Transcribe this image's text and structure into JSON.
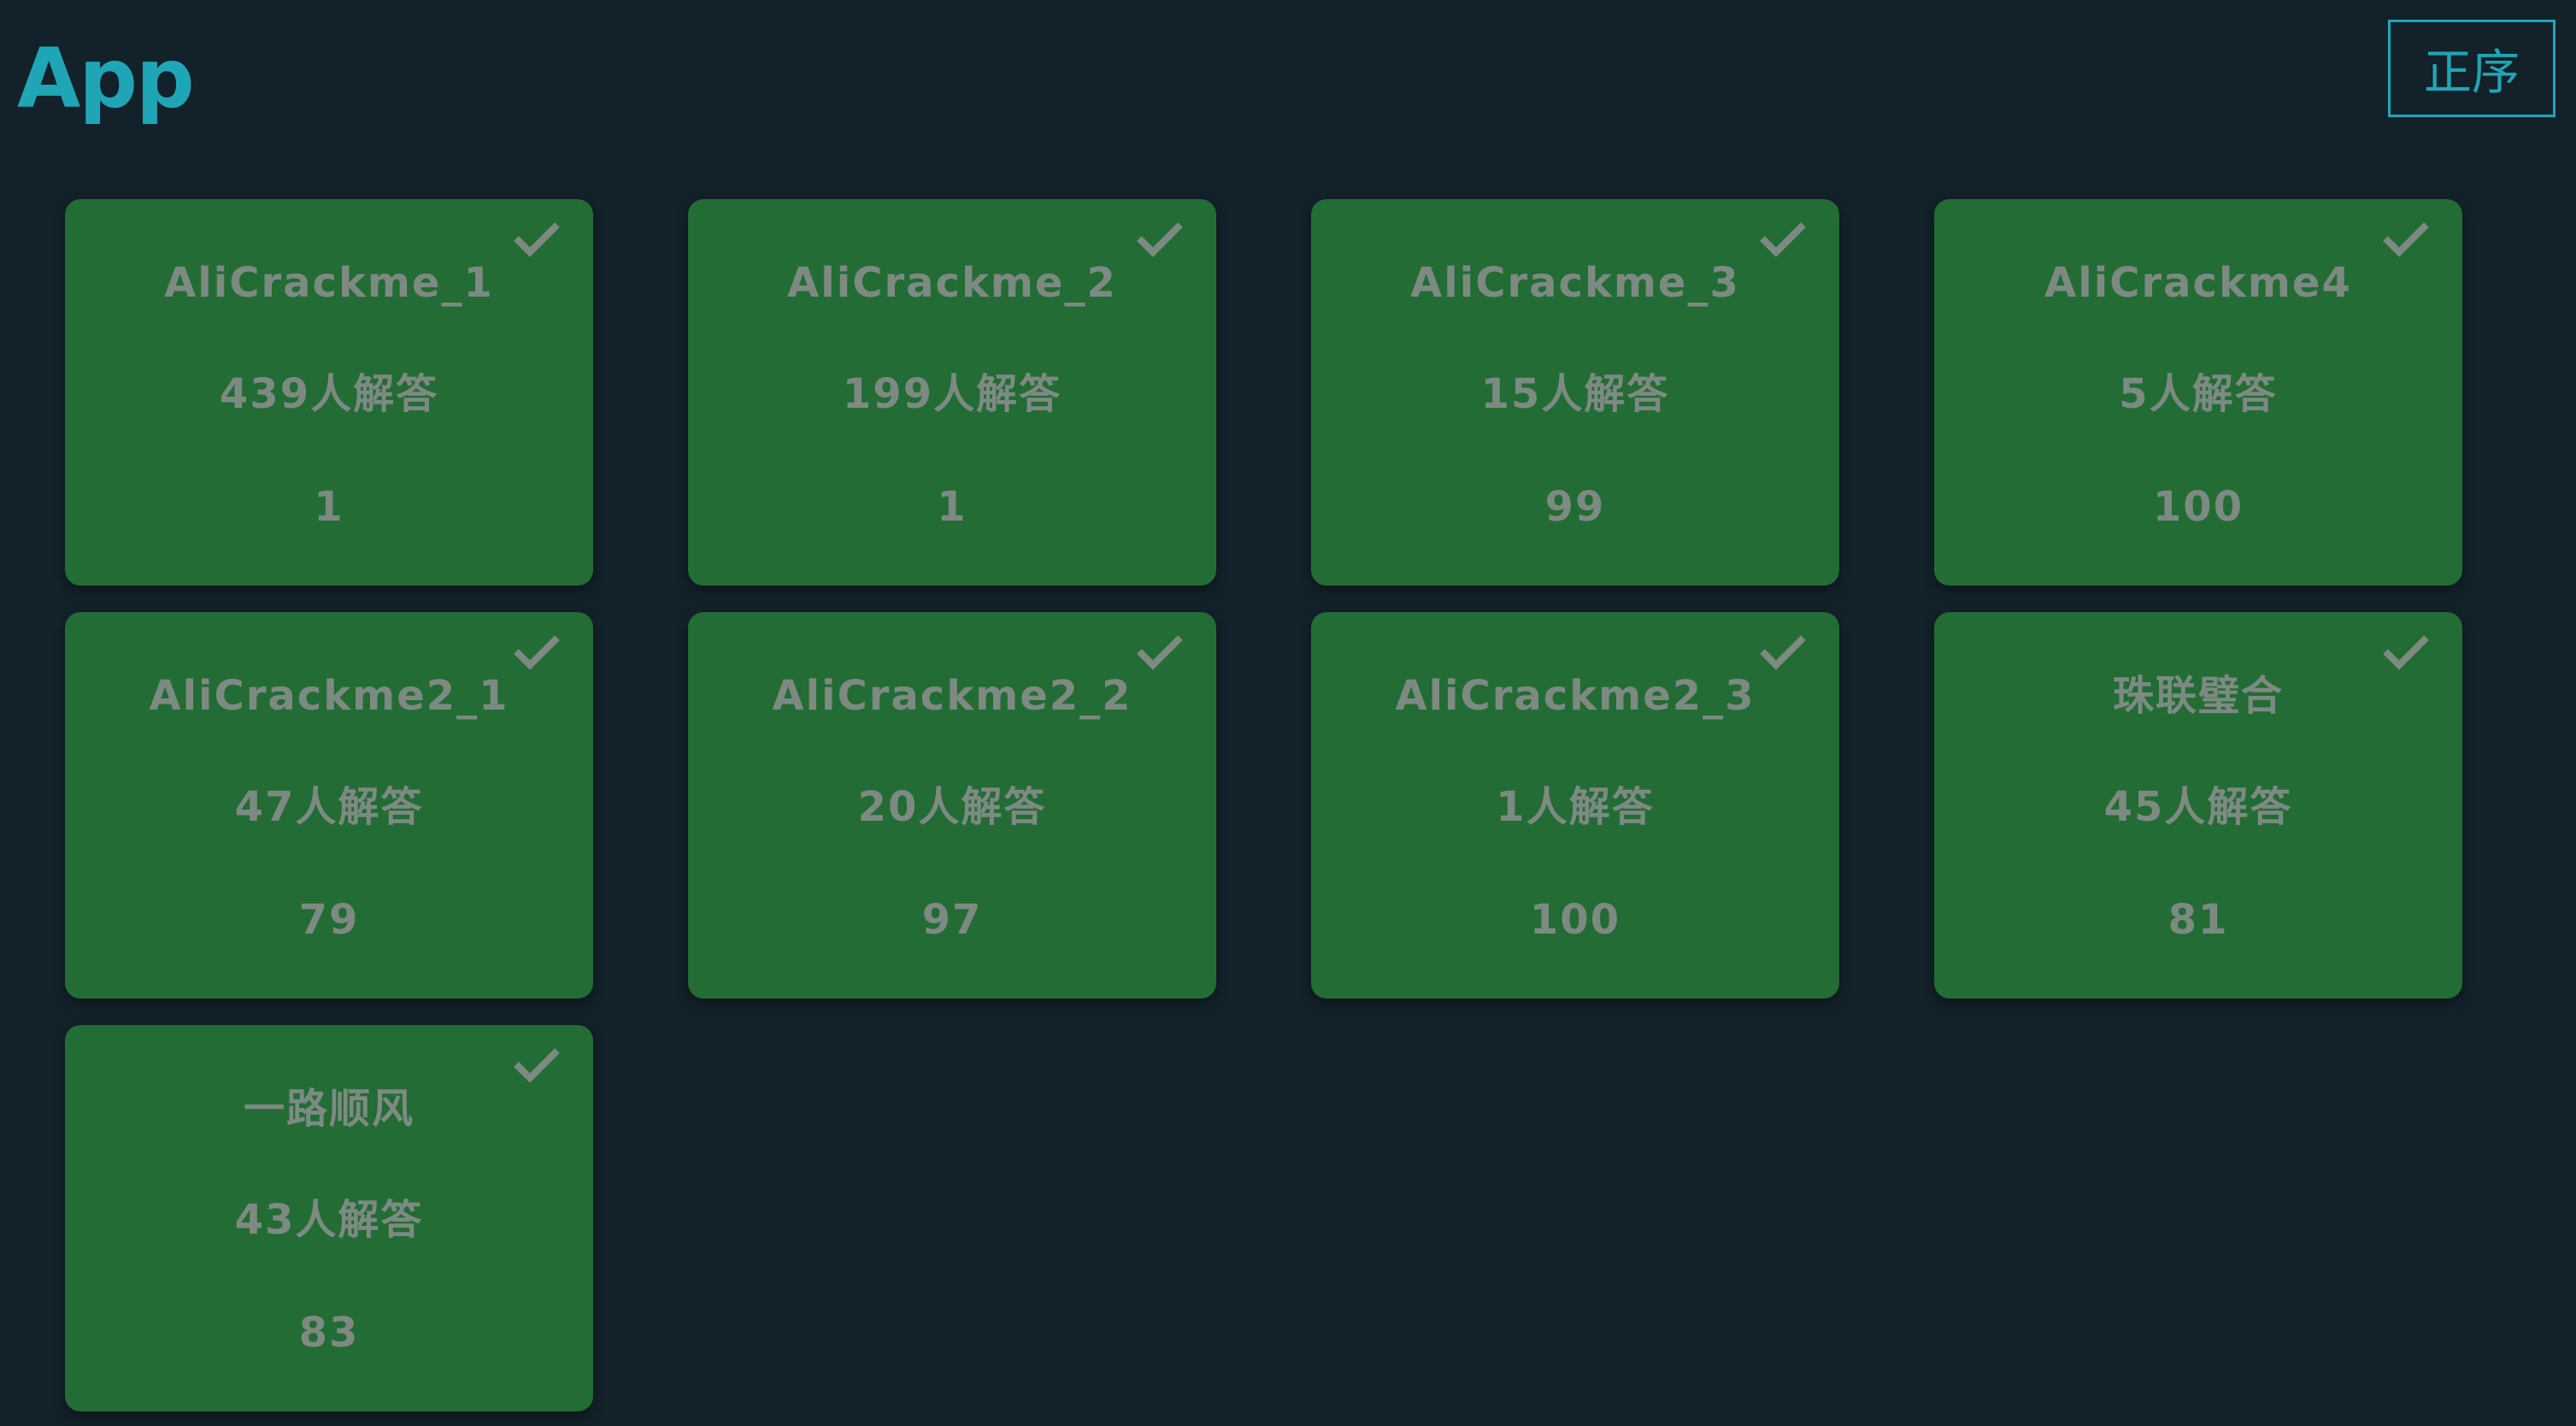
{
  "header": {
    "category": "App",
    "sort_label": "正序"
  },
  "challenges": [
    {
      "name": "AliCrackme_1",
      "solves": "439人解答",
      "points": "1",
      "solved": true
    },
    {
      "name": "AliCrackme_2",
      "solves": "199人解答",
      "points": "1",
      "solved": true
    },
    {
      "name": "AliCrackme_3",
      "solves": "15人解答",
      "points": "99",
      "solved": true
    },
    {
      "name": "AliCrackme4",
      "solves": "5人解答",
      "points": "100",
      "solved": true
    },
    {
      "name": "AliCrackme2_1",
      "solves": "47人解答",
      "points": "79",
      "solved": true
    },
    {
      "name": "AliCrackme2_2",
      "solves": "20人解答",
      "points": "97",
      "solved": true
    },
    {
      "name": "AliCrackme2_3",
      "solves": "1人解答",
      "points": "100",
      "solved": true
    },
    {
      "name": "珠联璧合",
      "solves": "45人解答",
      "points": "81",
      "solved": true
    },
    {
      "name": "一路顺风",
      "solves": "43人解答",
      "points": "83",
      "solved": true
    }
  ],
  "colors": {
    "background": "#13212a",
    "accent": "#1fa6b6",
    "card_solved": "#236c35",
    "card_text": "#7d8a82"
  },
  "icons": {
    "solved": "check-icon"
  }
}
